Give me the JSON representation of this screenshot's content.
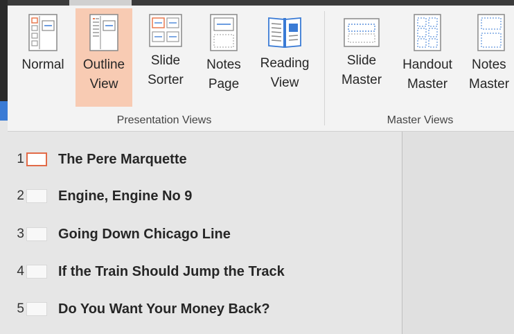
{
  "ribbon": {
    "presentation_views": {
      "label": "Presentation Views",
      "buttons": [
        {
          "line1": "Normal",
          "line2": ""
        },
        {
          "line1": "Outline",
          "line2": "View"
        },
        {
          "line1": "Slide",
          "line2": "Sorter"
        },
        {
          "line1": "Notes",
          "line2": "Page"
        },
        {
          "line1": "Reading",
          "line2": "View"
        }
      ]
    },
    "master_views": {
      "label": "Master Views",
      "buttons": [
        {
          "line1": "Slide",
          "line2": "Master"
        },
        {
          "line1": "Handout",
          "line2": "Master"
        },
        {
          "line1": "Notes",
          "line2": "Master"
        }
      ]
    }
  },
  "outline": {
    "slides": [
      {
        "number": "1",
        "title": "The Pere Marquette"
      },
      {
        "number": "2",
        "title": "Engine, Engine No 9"
      },
      {
        "number": "3",
        "title": "Going Down Chicago Line"
      },
      {
        "number": "4",
        "title": "If the Train Should Jump the Track"
      },
      {
        "number": "5",
        "title": "Do You Want Your Money Back?"
      }
    ]
  },
  "colors": {
    "active_button": "#f8cbb3",
    "selected_slide_border": "#e26a47",
    "icon_blue": "#3a7bd5",
    "icon_orange": "#e8784f"
  }
}
